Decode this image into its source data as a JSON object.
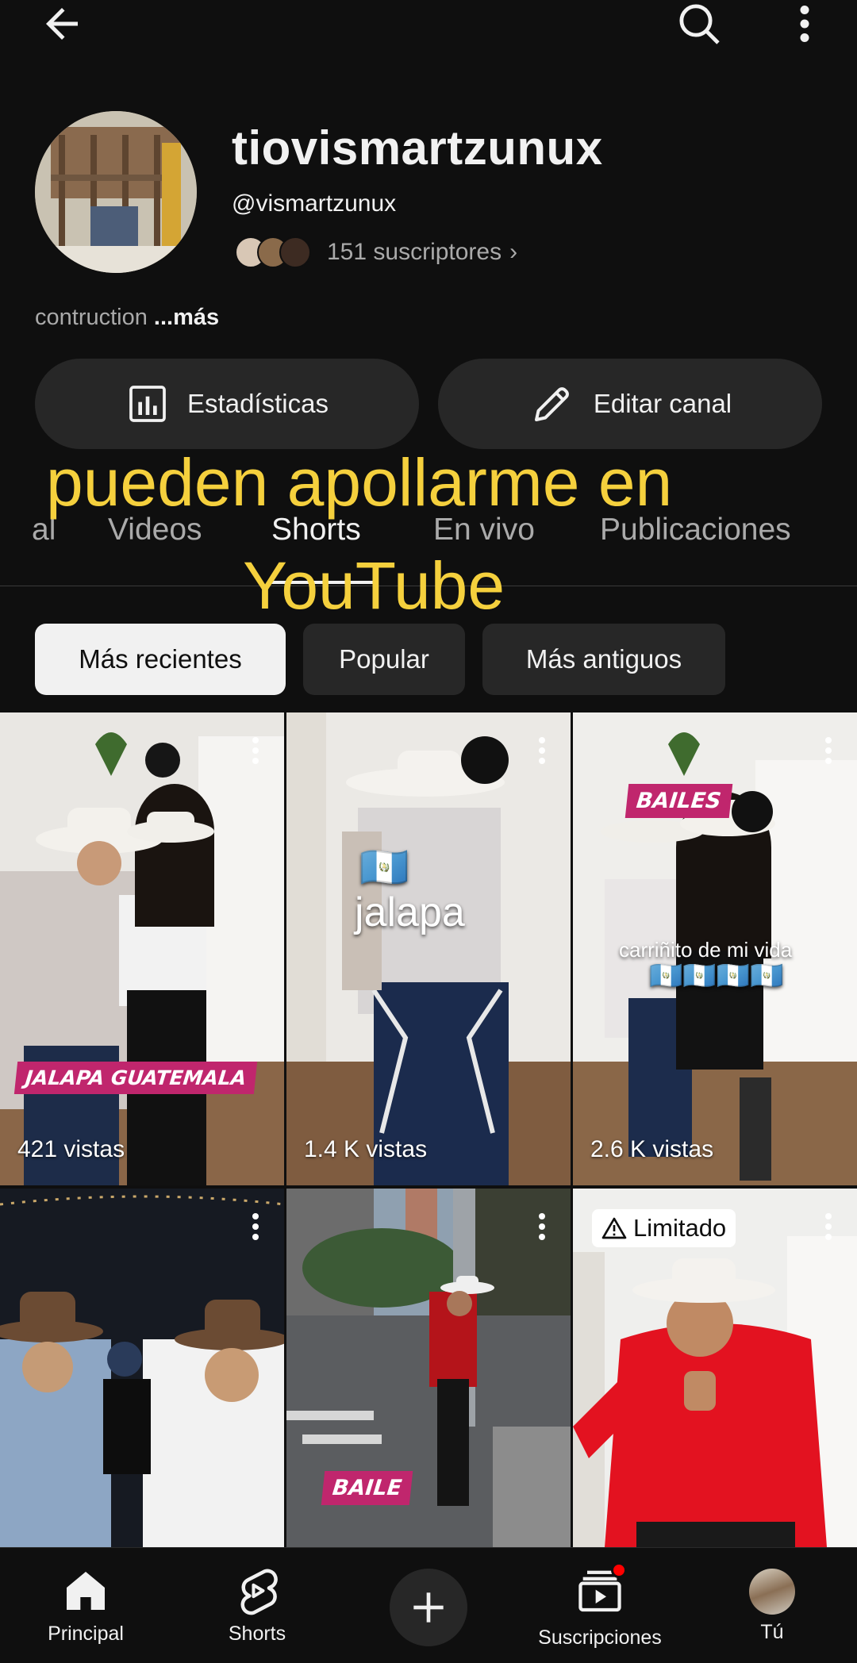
{
  "header": {
    "back_icon": "arrow-left-icon",
    "search_icon": "search-icon",
    "more_icon": "more-vertical-icon"
  },
  "channel": {
    "name": "tiovismartzunux",
    "handle": "@vismartzunux",
    "subscribers": "151 suscriptores",
    "subscribers_chevron": "›",
    "description": "contruction ",
    "description_more": "...más"
  },
  "actions": {
    "stats_label": "Estadísticas",
    "edit_label": "Editar canal"
  },
  "tabs": [
    {
      "label": "al"
    },
    {
      "label": "Videos"
    },
    {
      "label": "Shorts",
      "active": true
    },
    {
      "label": "En vivo"
    },
    {
      "label": "Publicaciones"
    }
  ],
  "overlay": {
    "line1": "pueden apollarme en",
    "line2": "YouTube",
    "color": "#f5d03d"
  },
  "chips": [
    {
      "label": "Más recientes",
      "selected": true
    },
    {
      "label": "Popular"
    },
    {
      "label": "Más antiguos"
    }
  ],
  "shorts": [
    {
      "views": "421 vistas",
      "tag": "JALAPA GUATEMALA"
    },
    {
      "views": "1.4 K vistas",
      "caption": "jalapa",
      "flag": "🇬🇹"
    },
    {
      "views": "2.6 K vistas",
      "tag": "BAILES",
      "caption": "carriñito de mi vida",
      "flags": "🇬🇹🇬🇹🇬🇹🇬🇹"
    },
    {
      "views": ""
    },
    {
      "views": "",
      "tag": "BAILE"
    },
    {
      "views": "",
      "badge": "Limitado"
    }
  ],
  "bottom_nav": {
    "home": "Principal",
    "shorts": "Shorts",
    "subscriptions": "Suscripciones",
    "you": "Tú"
  },
  "colors": {
    "background": "#0f0f0f",
    "surface": "#272727",
    "tag_pink": "#c0266d",
    "notification_red": "#ff0000"
  }
}
